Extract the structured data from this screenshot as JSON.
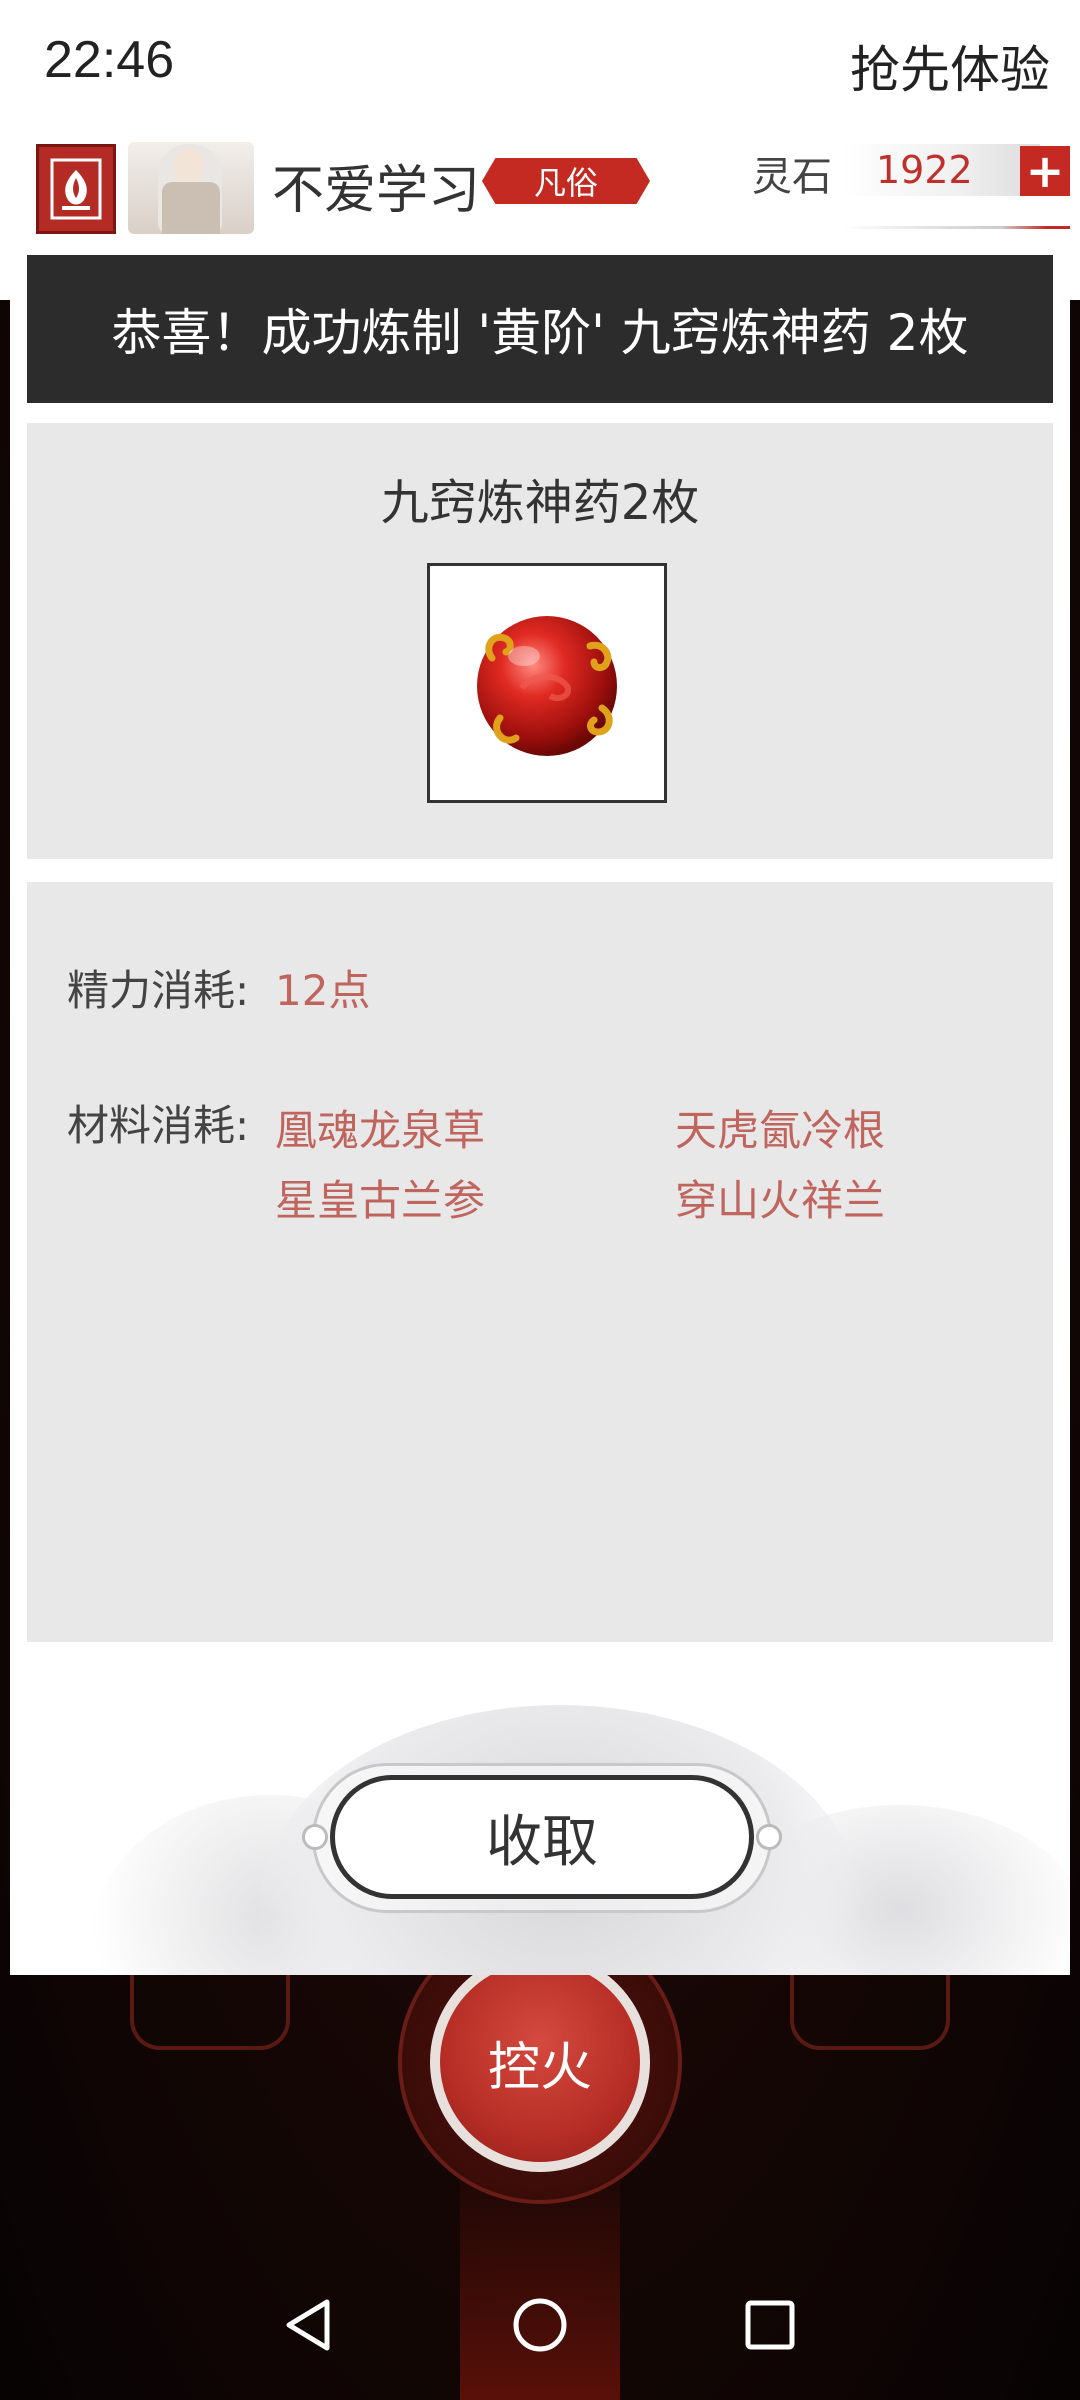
{
  "status_bar": {
    "time": "22:46",
    "early_access": "抢先体验"
  },
  "profile": {
    "username": "不爱学习",
    "rank": "凡俗",
    "stone_label": "灵石",
    "stone_value": "1922",
    "plus_label": "+"
  },
  "modal": {
    "title": "恭喜！成功炼制 '黄阶' 九窍炼神药 2枚",
    "result_name": "九窍炼神药2枚",
    "energy_label": "精力消耗:",
    "energy_value": "12点",
    "materials_label": "材料消耗:",
    "materials": [
      "凰魂龙泉草",
      "天虎氤冷根",
      "星皇古兰参",
      "穿山火祥兰"
    ],
    "collect_button": "收取"
  },
  "background": {
    "fire_button": "控火"
  },
  "colors": {
    "accent_red": "#c42a22",
    "cost_text": "#c0655e",
    "title_bar": "#2c2c2c",
    "panel_bg": "#e8e8e8"
  }
}
